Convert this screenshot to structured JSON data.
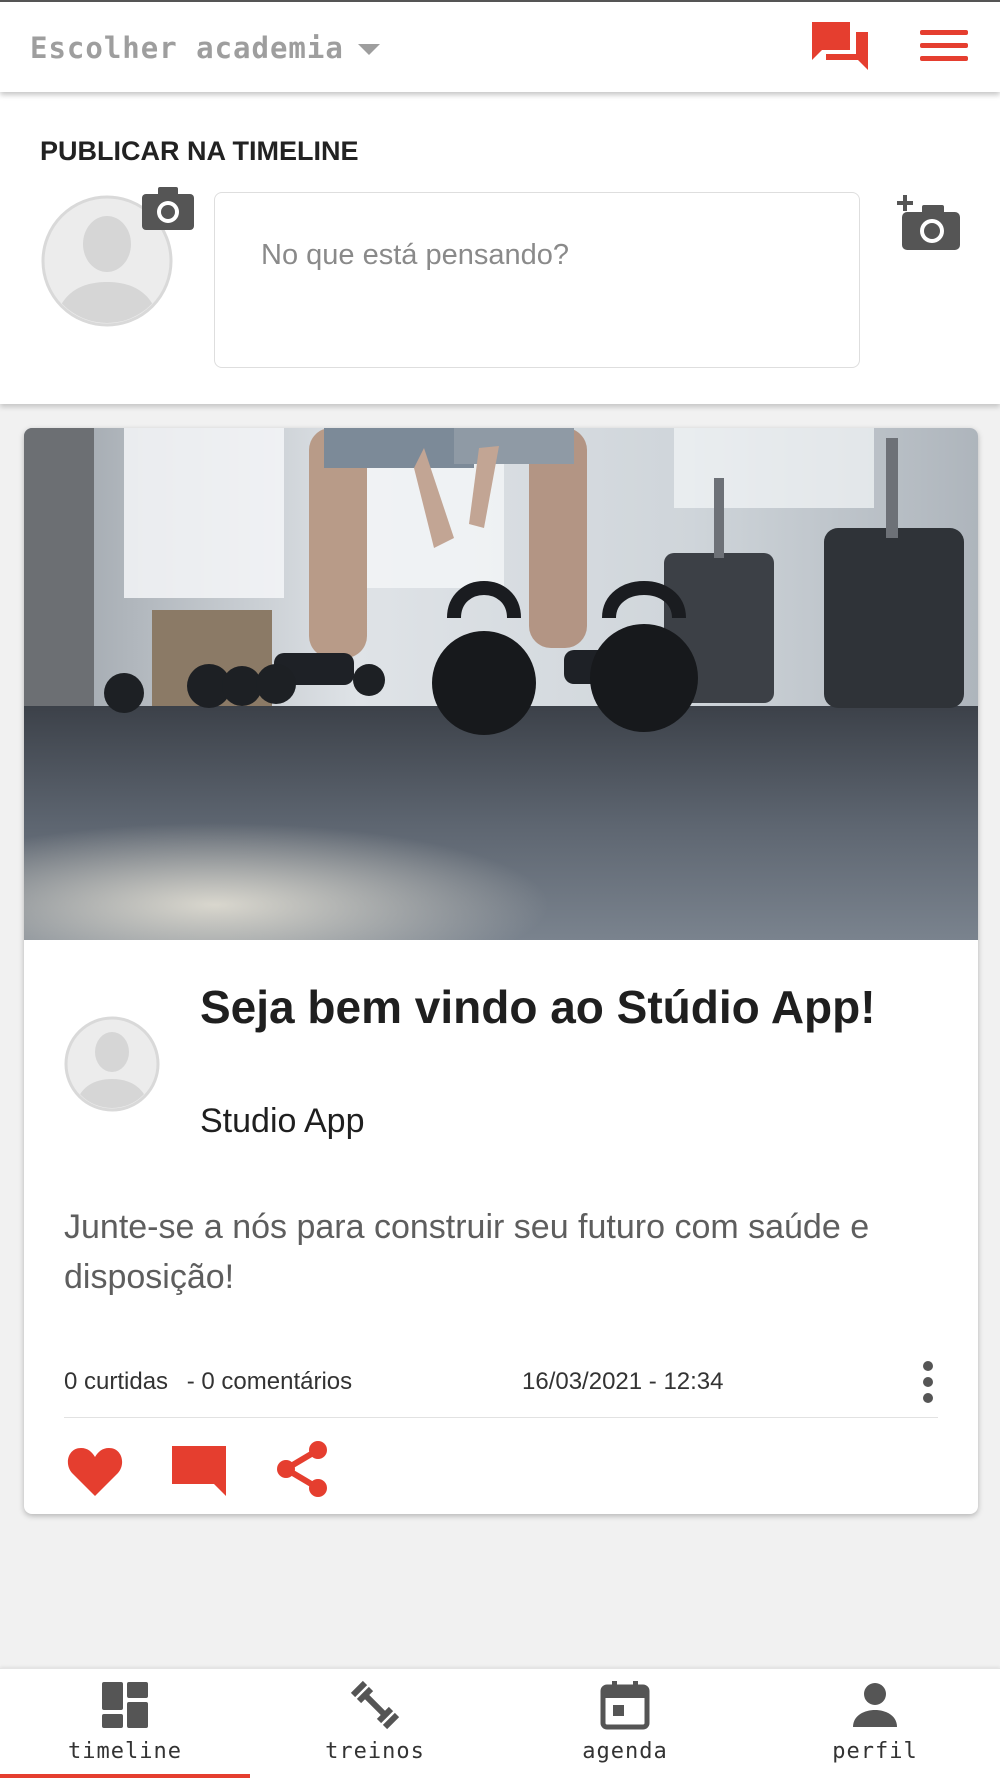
{
  "colors": {
    "accent": "#e53e2f",
    "muted": "#9e9e9e",
    "icon_dark": "#555555"
  },
  "header": {
    "gym_select_label": "Escolher academia",
    "icons": [
      "forum-icon",
      "hamburger-menu-icon"
    ]
  },
  "composer": {
    "title": "PUBLICAR NA TIMELINE",
    "placeholder": "No que está pensando?",
    "value": ""
  },
  "post": {
    "title": "Seja bem vindo ao Stúdio App!",
    "author": "Studio App",
    "text": "Junte-se a nós para construir seu futuro com saúde e disposição!",
    "likes": "0 curtidas",
    "comments": "- 0 comentários",
    "date": "16/03/2021 - 12:34"
  },
  "bottom_nav": {
    "items": [
      {
        "label": "timeline",
        "icon": "dashboard-icon",
        "active": true
      },
      {
        "label": "treinos",
        "icon": "dumbbell-icon",
        "active": false
      },
      {
        "label": "agenda",
        "icon": "calendar-icon",
        "active": false
      },
      {
        "label": "perfil",
        "icon": "person-icon",
        "active": false
      }
    ]
  }
}
